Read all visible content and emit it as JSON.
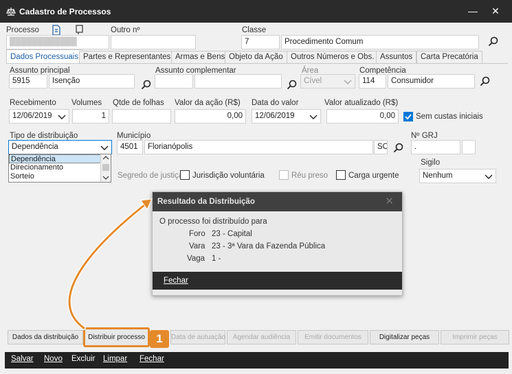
{
  "window": {
    "title": "Cadastro de Processos",
    "minimize_glyph": "—",
    "close_glyph": "✕"
  },
  "header": {
    "processo_label": "Processo",
    "processo_value": "████████████",
    "outro_label": "Outro nº",
    "classe_label": "Classe",
    "classe_code": "7",
    "classe_desc": "Procedimento Comum"
  },
  "tabs": [
    {
      "label": "Dados Processuais"
    },
    {
      "label": "Partes e Representantes"
    },
    {
      "label": "Armas e Bens"
    },
    {
      "label": "Objeto da Ação"
    },
    {
      "label": "Outros Números e Obs."
    },
    {
      "label": "Assuntos"
    },
    {
      "label": "Carta Precatória"
    }
  ],
  "form": {
    "assunto_principal_label": "Assunto principal",
    "assunto_code": "5915",
    "assunto_desc": "Isenção",
    "assunto_compl_label": "Assunto complementar",
    "area_label": "Área",
    "area_value": "Cível",
    "competencia_label": "Competência",
    "competencia_code": "114",
    "competencia_desc": "Consumidor",
    "recebimento_label": "Recebimento",
    "recebimento_value": "12/06/2019",
    "volumes_label": "Volumes",
    "volumes_value": "1",
    "qtde_label": "Qtde de folhas",
    "valor_acao_label": "Valor da ação (R$)",
    "valor_acao_value": "0,00",
    "data_valor_label": "Data do valor",
    "data_valor_value": "12/06/2019",
    "valor_atual_label": "Valor atualizado (R$)",
    "valor_atual_value": "0,00",
    "sem_custas_label": "Sem custas iniciais",
    "tipo_dist_label": "Tipo de distribuição",
    "tipo_dist_value": "Dependência",
    "tipo_dist_options": [
      "Dependência",
      "Direcionamento",
      "Sorteio"
    ],
    "municipio_label": "Município",
    "municipio_code": "4501",
    "municipio_desc": "Florianópolis",
    "municipio_uf": "SC",
    "grj_label": "Nº GRJ",
    "grj_value": ".",
    "segredo_label": "Segredo de justiça",
    "jurisdicao_label": "Jurisdição voluntária",
    "reu_preso_label": "Réu preso",
    "carga_urgente_label": "Carga urgente",
    "sigilo_label": "Sigilo",
    "sigilo_value": "Nenhum"
  },
  "modal": {
    "title": "Resultado da Distribuição",
    "message": "O processo foi distribuído para",
    "foro_label": "Foro",
    "foro_value": "23 - Capital",
    "vara_label": "Vara",
    "vara_value": "23 - 3ª Vara da Fazenda Pública",
    "vaga_label": "Vaga",
    "vaga_value": "1 -",
    "close_label": "Fechar"
  },
  "bottom_buttons": [
    {
      "label": "Dados da distribuição"
    },
    {
      "label": "Distribuir processo"
    },
    {
      "label": "Data de autuação"
    },
    {
      "label": "Agendar audiência"
    },
    {
      "label": "Emitir documentos"
    },
    {
      "label": "Digitalizar peças"
    },
    {
      "label": "Imprimir peças"
    }
  ],
  "callout_number": "1",
  "toolbar": {
    "salvar": "Salvar",
    "novo": "Novo",
    "excluir": "Excluir",
    "limpar": "Limpar",
    "fechar": "Fechar"
  },
  "colors": {
    "titlebar": "#2b2b2b",
    "accent_orange": "#e58a2b",
    "checkbox_blue": "#0078d7",
    "tab_active_text": "#1a5fa8"
  }
}
